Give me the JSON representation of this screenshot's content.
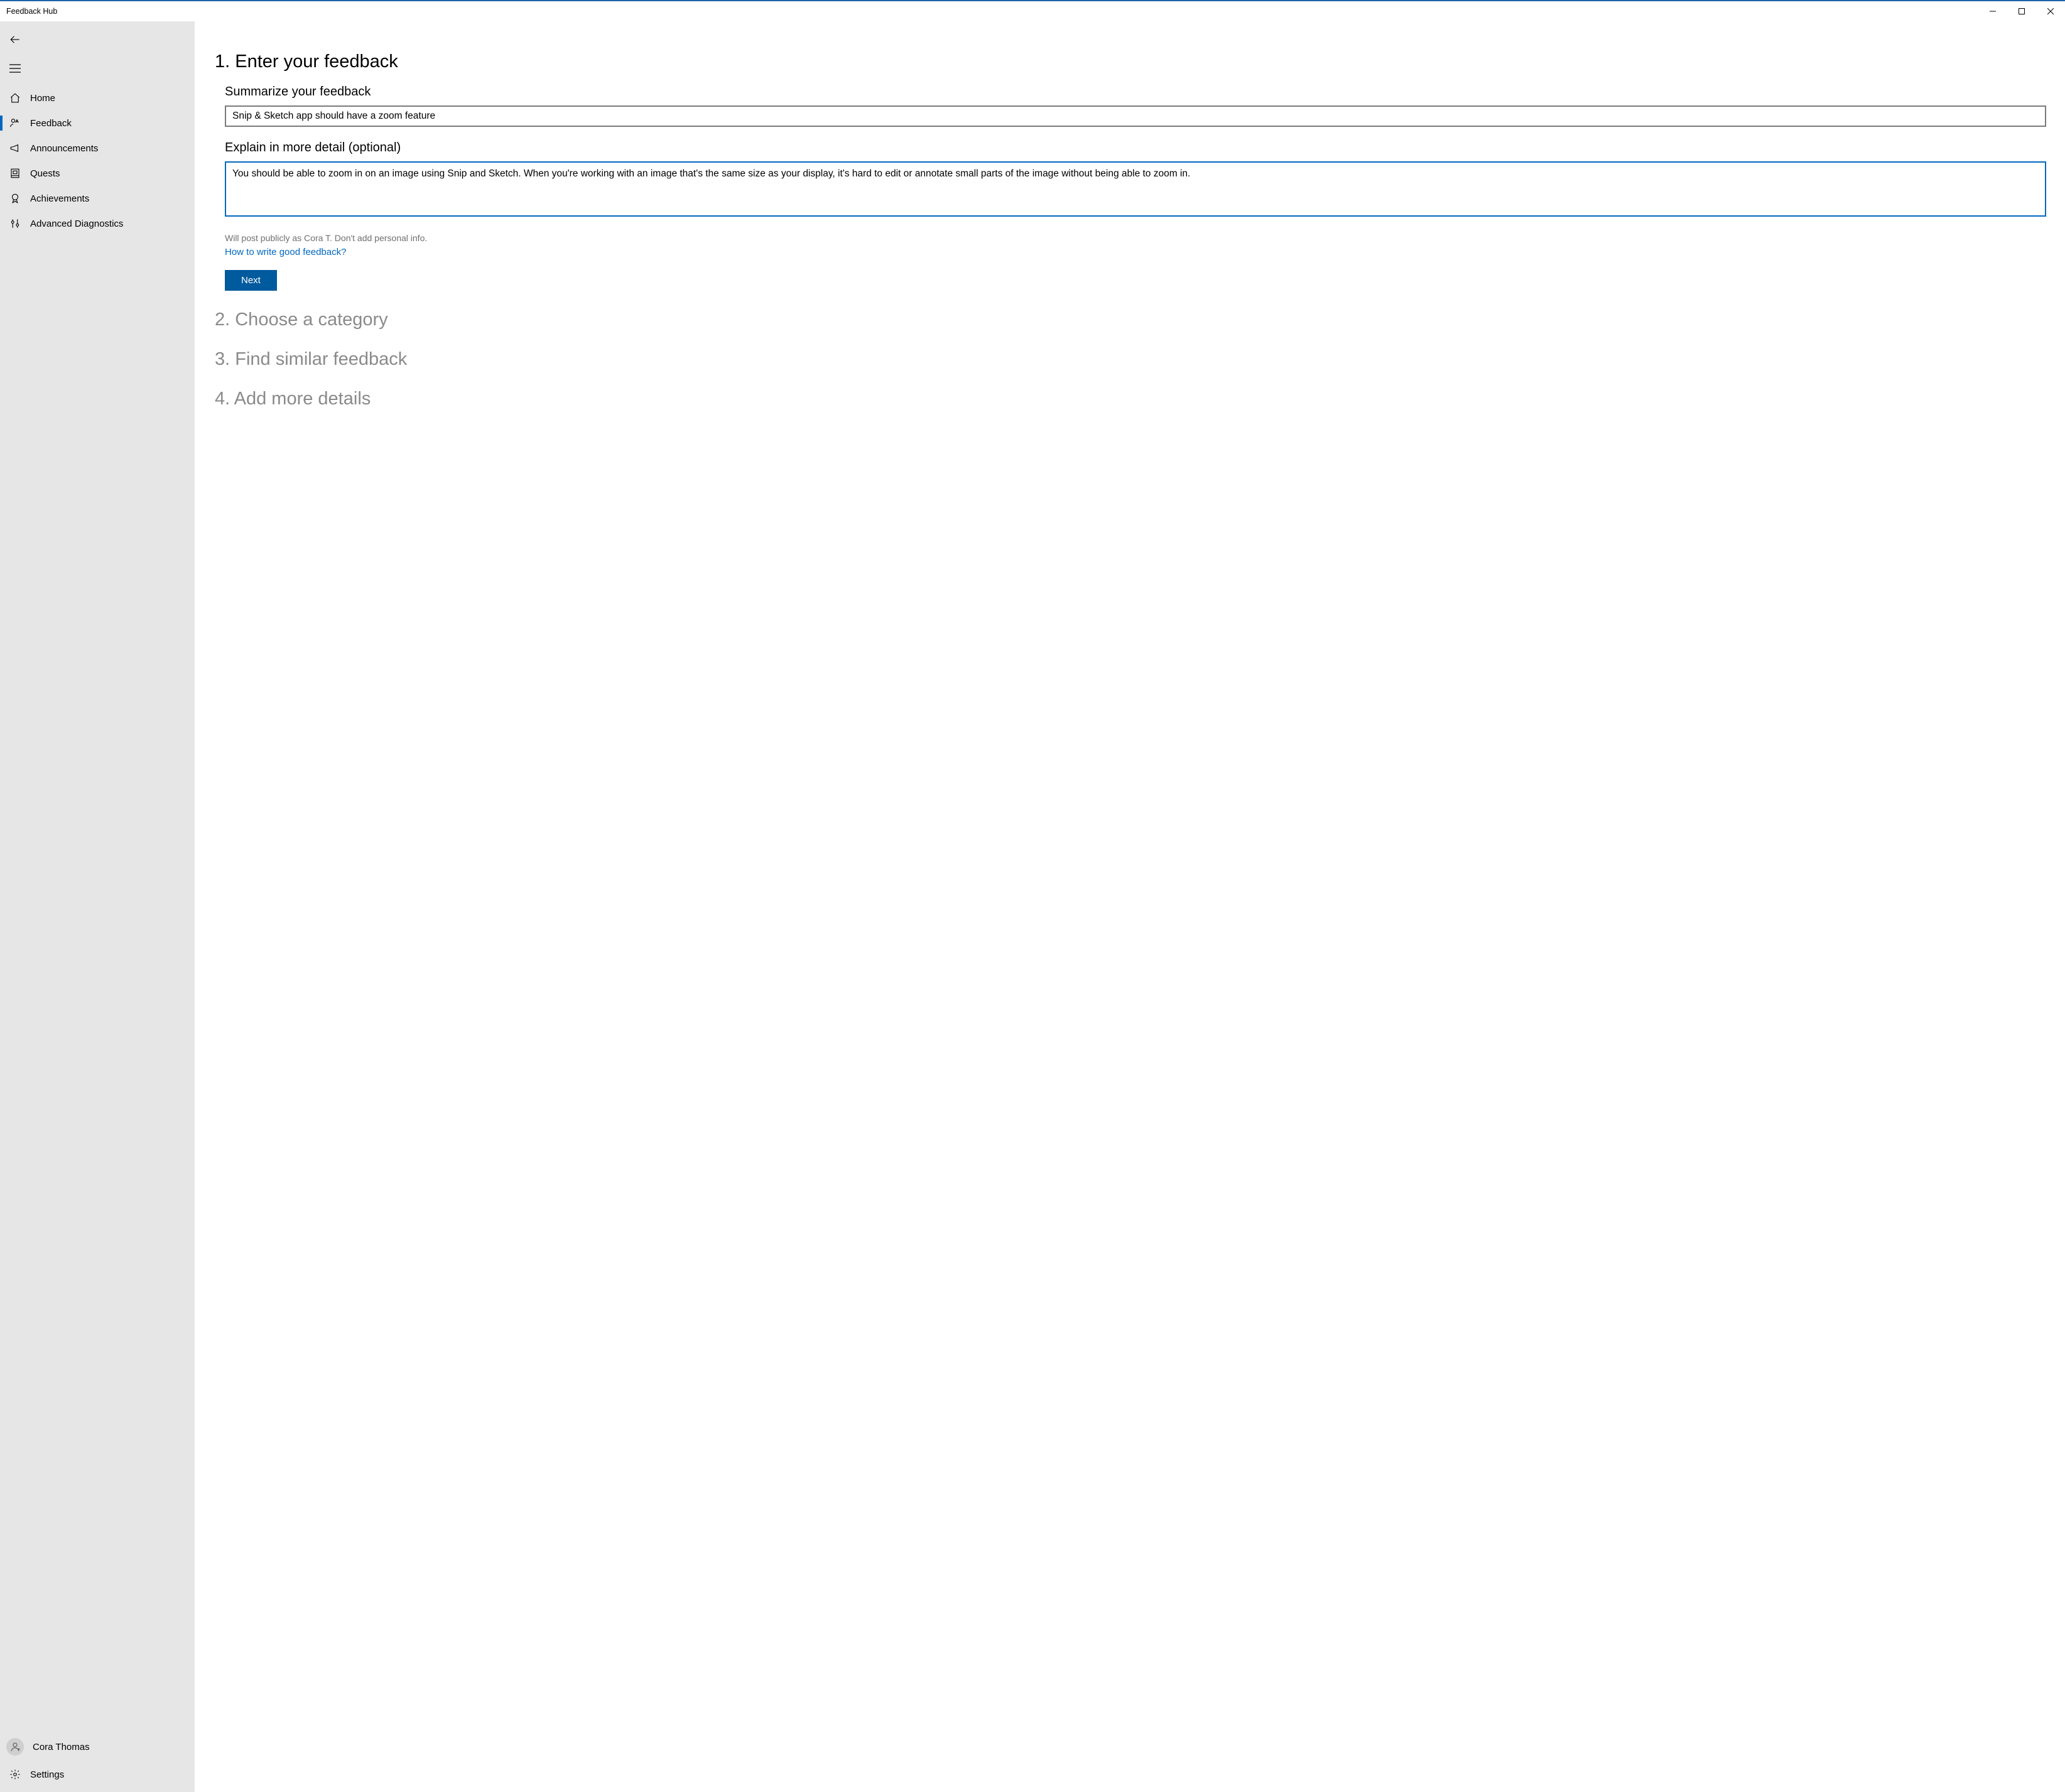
{
  "window": {
    "title": "Feedback Hub"
  },
  "sidebar": {
    "items": [
      {
        "label": "Home"
      },
      {
        "label": "Feedback"
      },
      {
        "label": "Announcements"
      },
      {
        "label": "Quests"
      },
      {
        "label": "Achievements"
      },
      {
        "label": "Advanced Diagnostics"
      }
    ],
    "user": {
      "name": "Cora Thomas"
    },
    "settings_label": "Settings"
  },
  "form": {
    "step1_title": "1. Enter your feedback",
    "summary_label": "Summarize your feedback",
    "summary_value": "Snip & Sketch app should have a zoom feature",
    "detail_label": "Explain in more detail (optional)",
    "detail_value": "You should be able to zoom in on an image using Snip and Sketch. When you're working with an image that's the same size as your display, it's hard to edit or annotate small parts of the image without being able to zoom in.",
    "disclaimer": "Will post publicly as Cora T. Don't add personal info.",
    "help_link": "How to write good feedback?",
    "next_label": "Next",
    "step2_title": "2. Choose a category",
    "step3_title": "3. Find similar feedback",
    "step4_title": "4. Add more details"
  }
}
